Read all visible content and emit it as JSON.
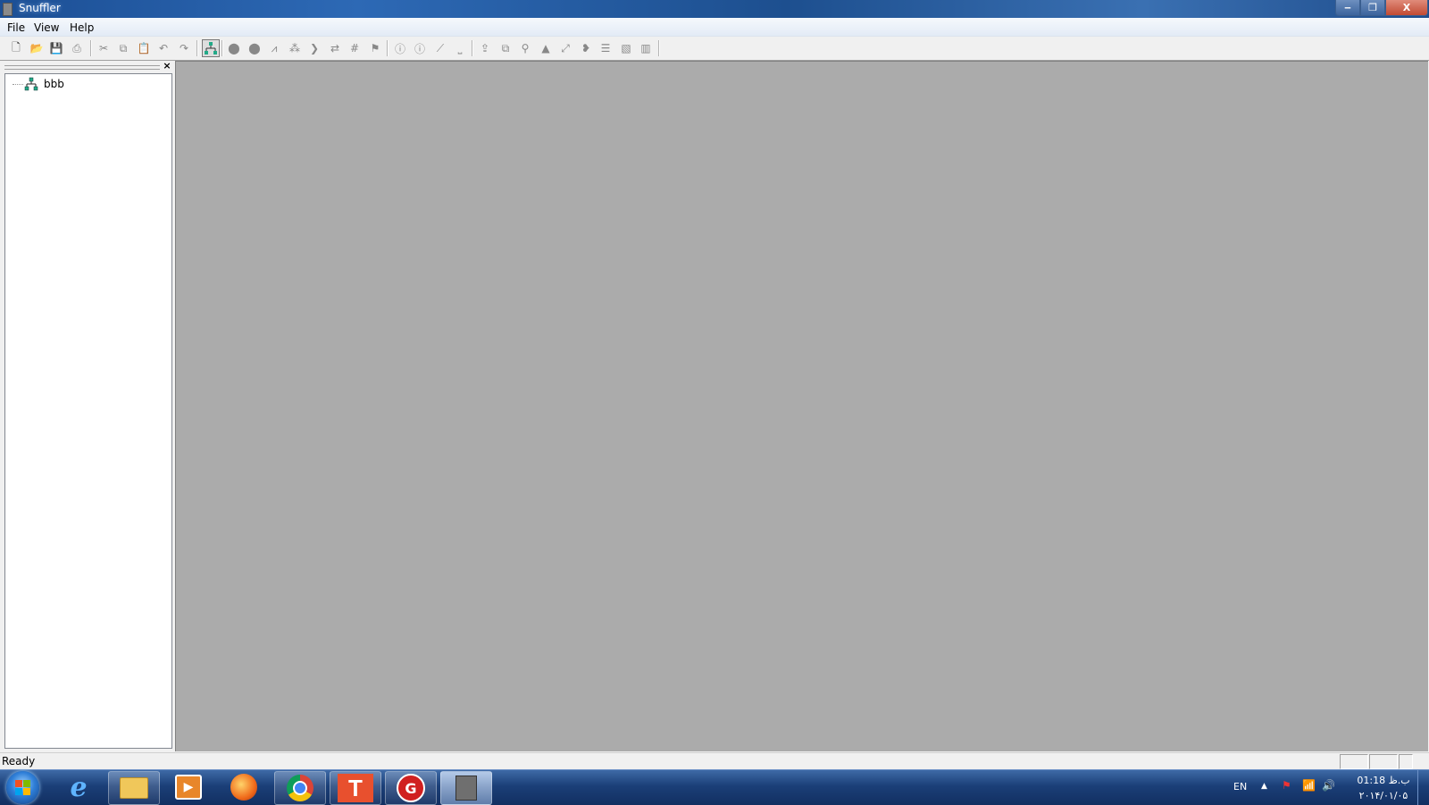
{
  "window": {
    "title": "Snuffler",
    "min_glyph": "‒",
    "max_glyph": "❐",
    "close_glyph": "X"
  },
  "menu": {
    "file": "File",
    "view": "View",
    "help": "Help"
  },
  "toolbar": {
    "icons": [
      "new-icon",
      "open-icon",
      "save-icon",
      "print-icon",
      "cut-icon",
      "copy-icon",
      "paste-icon",
      "undo-icon",
      "redo-icon",
      "network-tree-icon",
      "zoom-in-icon",
      "zoom-out-icon",
      "chart-icon",
      "scatter-icon",
      "forward-icon",
      "swap-icon",
      "grid-icon",
      "flag-icon",
      "info-icon",
      "info-alt-icon",
      "line-icon",
      "ruler-icon",
      "import-icon",
      "layers-icon",
      "split-icon",
      "mountain-icon",
      "resize-icon",
      "spiral-icon",
      "lines-icon",
      "panel-icon",
      "columns-icon"
    ]
  },
  "left_pane": {
    "close_glyph": "×",
    "tree": [
      {
        "label": "bbb",
        "icon": "network-node-icon"
      }
    ]
  },
  "status": {
    "text": "Ready"
  },
  "taskbar": {
    "apps": [
      "ie-icon",
      "explorer-folder-icon",
      "media-player-icon",
      "firefox-icon",
      "chrome-icon",
      "t-app-icon",
      "recorder-icon",
      "snuffler-app-icon"
    ],
    "ie_glyph": "e",
    "t_glyph": "T",
    "media_glyph": "▶",
    "rec_glyph": "G",
    "language": "EN",
    "tray_arrow": "▲",
    "time": "01:18 ب.ظ",
    "date": "۲۰۱۴/۰۱/۰۵"
  }
}
